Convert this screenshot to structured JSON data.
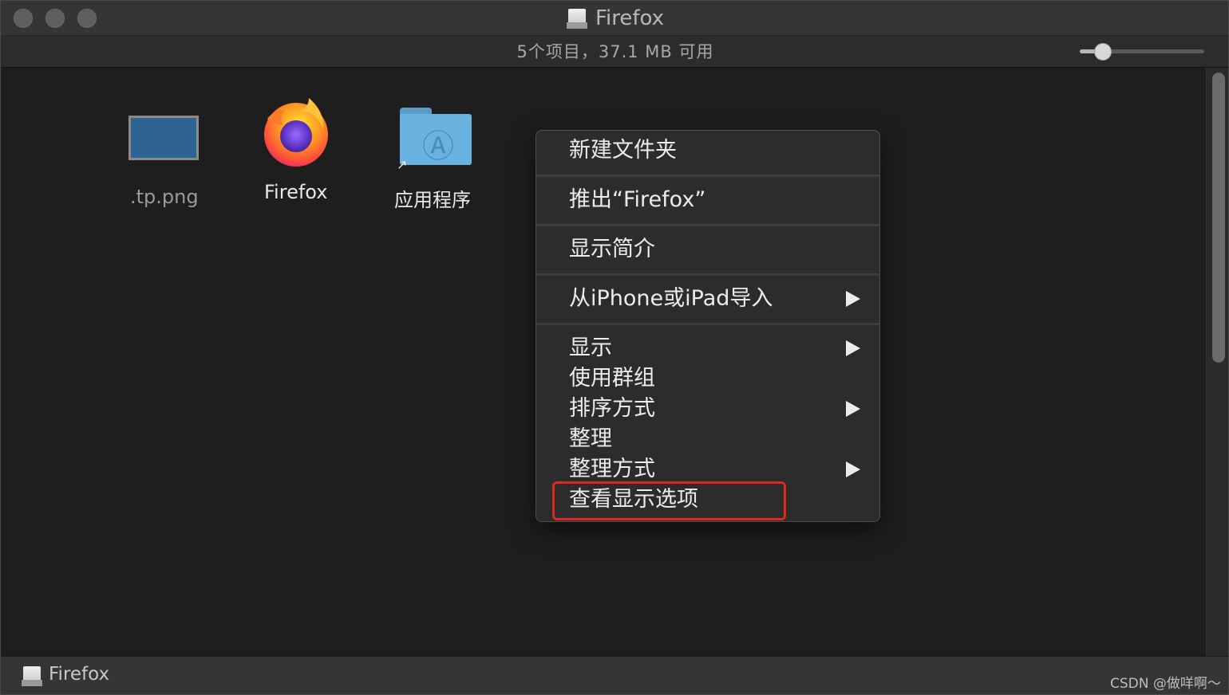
{
  "window": {
    "title": "Firefox",
    "status": "5个项目，37.1 MB 可用"
  },
  "files": [
    {
      "name": ".tp.png",
      "kind": "image",
      "icon": "png-thumbnail-icon"
    },
    {
      "name": "Firefox",
      "kind": "app",
      "icon": "firefox-icon"
    },
    {
      "name": "应用程序",
      "kind": "alias-folder",
      "icon": "applications-folder-icon"
    }
  ],
  "context_menu": {
    "items": [
      {
        "label": "新建文件夹",
        "submenu": false
      },
      {
        "label": "推出“Firefox”",
        "submenu": false
      },
      {
        "label": "显示简介",
        "submenu": false
      },
      {
        "label": "从iPhone或iPad导入",
        "submenu": true
      },
      {
        "label": "显示",
        "submenu": true
      },
      {
        "label": "使用群组",
        "submenu": false
      },
      {
        "label": "排序方式",
        "submenu": true
      },
      {
        "label": "整理",
        "submenu": false
      },
      {
        "label": "整理方式",
        "submenu": true
      },
      {
        "label": "查看显示选项",
        "submenu": false,
        "highlighted": true
      }
    ]
  },
  "bottom_bar": {
    "path_label": "Firefox"
  },
  "watermark": "CSDN @做咩啊～",
  "colors": {
    "highlight_border": "#e0281f",
    "window_bg": "#1e1e1e",
    "menu_bg": "#2c2c2c"
  }
}
